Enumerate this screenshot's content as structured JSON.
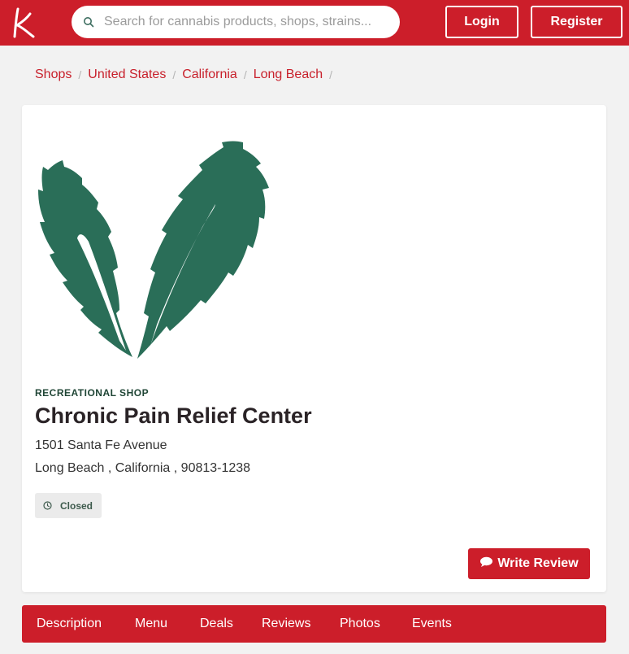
{
  "header": {
    "logo_letter": "k",
    "search_placeholder": "Search for cannabis products, shops, strains...",
    "search_value": "",
    "login_label": "Login",
    "register_label": "Register"
  },
  "breadcrumb": [
    "Shops",
    "United States",
    "California",
    "Long Beach"
  ],
  "shop": {
    "type": "RECREATIONAL SHOP",
    "name": "Chronic Pain Relief Center",
    "address_line1": "1501 Santa Fe Avenue",
    "address_line2": "Long Beach , California , 90813-1238",
    "status": "Closed",
    "write_review_label": "Write Review"
  },
  "tabs": [
    "Description",
    "Menu",
    "Deals",
    "Reviews",
    "Photos",
    "Events"
  ],
  "colors": {
    "brand_red": "#cc1e2a",
    "leaf_green": "#2a6e58",
    "page_bg": "#f2f2f2"
  }
}
